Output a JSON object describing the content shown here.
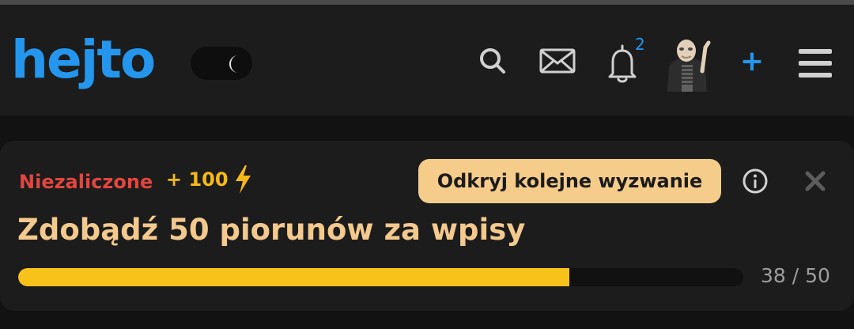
{
  "header": {
    "logo": "hejto",
    "notifications_count": "2",
    "add_label": "+"
  },
  "challenge": {
    "status": "Niezaliczone",
    "points": "+ 100",
    "action_label": "Odkryj kolejne wyzwanie",
    "title": "Zdobądź 50 piorunów za wpisy",
    "progress_current": 38,
    "progress_total": 50,
    "progress_text": "38 / 50"
  },
  "colors": {
    "accent": "#2496ed",
    "status": "#e2463f",
    "points": "#f5b917",
    "progress": "#f7c31a",
    "button": "#f6cc8b"
  },
  "icons": [
    "moon-icon",
    "search-icon",
    "mail-icon",
    "bell-icon",
    "avatar",
    "plus-icon",
    "menu-icon",
    "bolt-icon",
    "info-icon",
    "close-icon"
  ]
}
